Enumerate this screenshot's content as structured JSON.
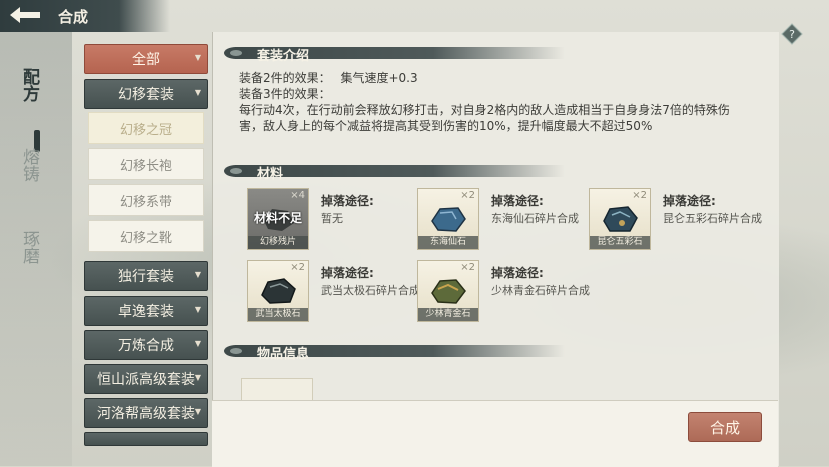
{
  "header": {
    "title": "合成"
  },
  "leftnav": {
    "tabs": [
      {
        "label": "配方",
        "active": true
      },
      {
        "label": "熔铸",
        "active": false
      },
      {
        "label": "琢磨",
        "active": false
      }
    ]
  },
  "sets": {
    "all": "全部",
    "huanyi": "幻移套装",
    "huanyi_items": [
      "幻移之冠",
      "幻移长袍",
      "幻移系带",
      "幻移之靴"
    ],
    "others": [
      "独行套装",
      "卓逸套装",
      "万炼合成",
      "恒山派高级套装",
      "河洛帮高级套装"
    ]
  },
  "set_intro": {
    "header": "套装介绍",
    "line1_label": "装备2件的效果：",
    "line1_value": "集气速度+0.3",
    "line2_label": "装备3件的效果：",
    "line3": "每行动4次，在行动前会释放幻移打击，对自身2格内的敌人造成相当于自身身法7倍的特殊伤",
    "line4": "害，敌人身上的每个减益将提高其受到伤害的10%，提升幅度最大不超过50%"
  },
  "materials": {
    "header": "材料",
    "source_label": "掉落途径:",
    "items": [
      {
        "name": "幻移残片",
        "count": "×4",
        "source": "暂无",
        "insufficient": "材料不足",
        "color": "#3a3d3c"
      },
      {
        "name": "东海仙石",
        "count": "×2",
        "source": "东海仙石碎片合成",
        "color": "#3c6a8c"
      },
      {
        "name": "昆仑五彩石",
        "count": "×2",
        "source": "昆仑五彩石碎片合成",
        "color": "#2f4a5a"
      },
      {
        "name": "武当太极石",
        "count": "×2",
        "source": "武当太极石碎片合成",
        "color": "#2b3436"
      },
      {
        "name": "少林青金石",
        "count": "×2",
        "source": "少林青金石碎片合成",
        "color": "#5d6a3a"
      }
    ]
  },
  "item_info": {
    "header": "物品信息"
  },
  "actions": {
    "compose": "合成"
  },
  "colors": {
    "accent": "#b56450",
    "dark": "#3e4949"
  }
}
